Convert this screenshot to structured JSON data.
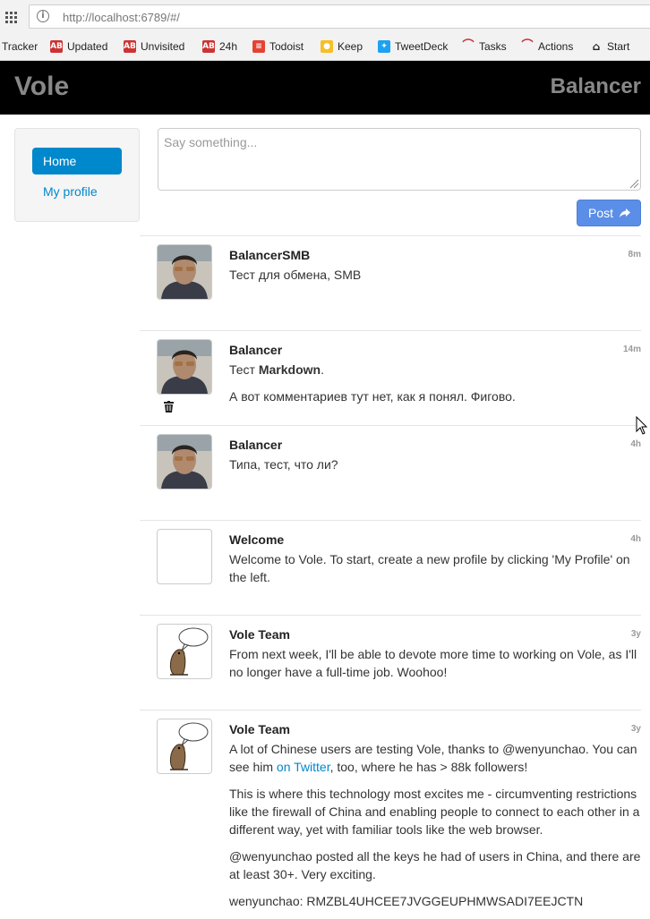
{
  "browser": {
    "url": "http://localhost:6789/#/",
    "bookmarks": [
      {
        "label": "Tracker"
      },
      {
        "label": "Updated",
        "icon": "ab-icon"
      },
      {
        "label": "Unvisited",
        "icon": "ab-icon"
      },
      {
        "label": "24h",
        "icon": "ab-icon"
      },
      {
        "label": "Todoist",
        "icon": "todoist-icon"
      },
      {
        "label": "Keep",
        "icon": "keep-icon"
      },
      {
        "label": "TweetDeck",
        "icon": "tweetdeck-icon"
      },
      {
        "label": "Tasks",
        "icon": "tasks-icon"
      },
      {
        "label": "Actions",
        "icon": "actions-icon"
      },
      {
        "label": "Start",
        "icon": "home-icon"
      }
    ]
  },
  "header": {
    "brand": "Vole",
    "user": "Balancer"
  },
  "sidebar": {
    "home": "Home",
    "my_profile": "My profile"
  },
  "compose": {
    "placeholder": "Say something...",
    "post_label": "Post"
  },
  "posts": [
    {
      "author": "BalancerSMB",
      "time": "8m",
      "avatar": "photo",
      "paragraphs": [
        "Тест для обмена, SMB"
      ]
    },
    {
      "author": "Balancer",
      "time": "14m",
      "avatar": "photo",
      "deletable": true,
      "p1_prefix": "Тест ",
      "p1_bold": "Markdown",
      "p1_suffix": ".",
      "p2": "А вот комментариев тут нет, как я понял. Фигово."
    },
    {
      "author": "Balancer",
      "time": "4h",
      "avatar": "photo",
      "paragraphs": [
        "Типа, тест, что ли?"
      ]
    },
    {
      "author": "Welcome",
      "time": "4h",
      "avatar": "blank",
      "paragraphs": [
        "Welcome to Vole. To start, create a new profile by clicking 'My Profile' on the left."
      ]
    },
    {
      "author": "Vole Team",
      "time": "3y",
      "avatar": "vole",
      "paragraphs": [
        "From next week, I'll be able to devote more time to working on Vole, as I'll no longer have a full-time job. Woohoo!"
      ]
    },
    {
      "author": "Vole Team",
      "time": "3y",
      "avatar": "vole",
      "p1_prefix": "A lot of Chinese users are testing Vole, thanks to @wenyunchao. You can see him ",
      "p1_link": "on Twitter",
      "p1_suffix": ", too, where he has > 88k followers!",
      "p2": "This is where this technology most excites me - circumventing restrictions like the firewall of China and enabling people to connect to each other in a different way, yet with familiar tools like the web browser.",
      "p3": "@wenyunchao posted all the keys he had of users in China, and there are at least 30+. Very exciting.",
      "p4": "wenyunchao: RMZBL4UHCEE7JVGGEUPHMWSADI7EEJCTN"
    }
  ]
}
